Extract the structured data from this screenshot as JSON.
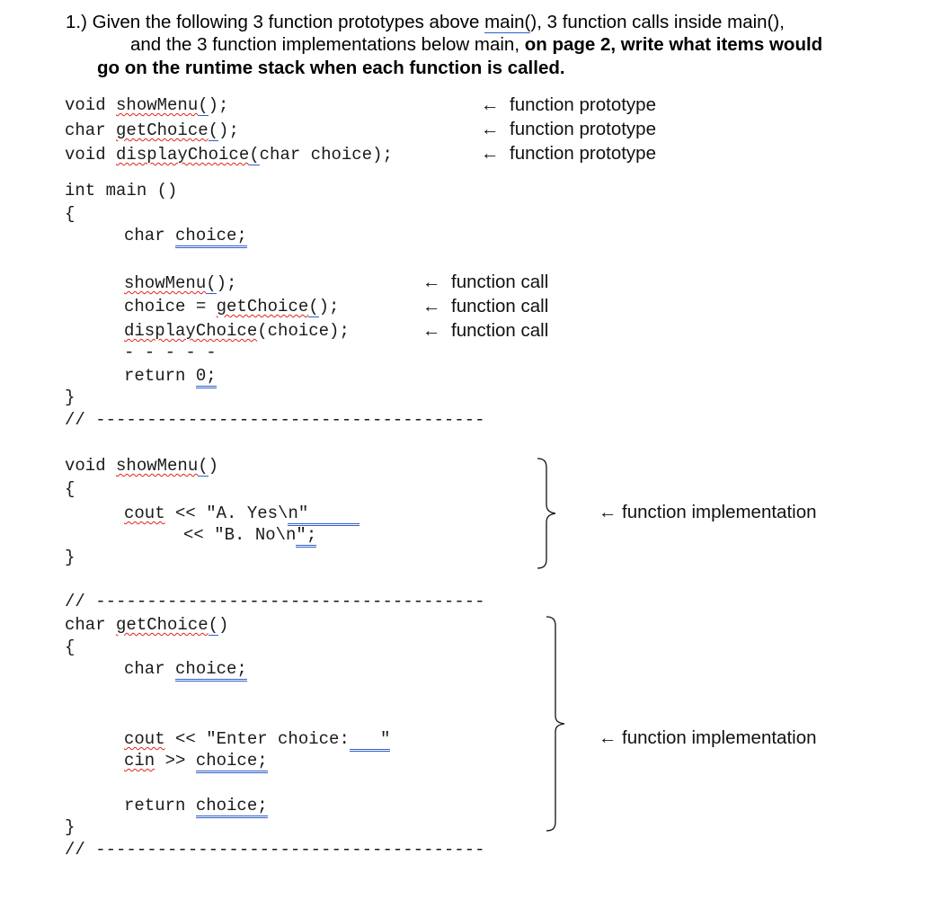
{
  "question": {
    "number": "1.)",
    "line1_pre": "Given the following 3 function prototypes above ",
    "line1_link": "main(",
    "line1_post": "), 3 function calls inside main(),",
    "line2_plain": "and the 3 function implementations below main, ",
    "line2_bold": "on page 2, write what items would",
    "line3_bold": "go on the runtime stack when each function is called."
  },
  "prototypes": [
    {
      "type": "void ",
      "name": "showMenu",
      "paren": "(",
      "rest": ");",
      "annotation": "function prototype"
    },
    {
      "type": "char ",
      "name": "getChoice",
      "paren": "(",
      "rest": ");",
      "annotation": "function prototype"
    },
    {
      "type": "void ",
      "name": "displayChoice",
      "paren": "(",
      "rest": "char choice);",
      "annotation": "function prototype"
    }
  ],
  "arrow": "←",
  "main": {
    "signature": "int main ()",
    "open_brace": "{",
    "decl_type": "char ",
    "decl_var": "choice;",
    "calls": [
      {
        "pre": "",
        "name": "showMenu",
        "paren": "(",
        "rest": ");",
        "annotation": "function call"
      },
      {
        "pre": "choice = ",
        "name": "getChoice",
        "paren": "(",
        "rest": ");",
        "annotation": "function call"
      },
      {
        "pre": "",
        "name": "displayChoice",
        "paren": "",
        "rest": "(choice);",
        "annotation": "function call"
      }
    ],
    "ellipsis": "- - - - -",
    "return_kw": "return ",
    "return_val": "0;",
    "close_brace": "}"
  },
  "separator": "// --------------------------------------",
  "showMenu_impl": {
    "signature_type": "void ",
    "signature_name": "showMenu",
    "signature_paren": "(",
    "signature_rest": ")",
    "open_brace": "{",
    "cout": "cout",
    "line1_mid": " << \"A. Yes\\",
    "line1_u": "n\"     ",
    "line2_pre": "<< \"B. No\\n",
    "line2_u": "\";",
    "close_brace": "}",
    "annotation": "function implementation"
  },
  "getChoice_impl": {
    "signature_type": "char ",
    "signature_name": "getChoice",
    "signature_paren": "(",
    "signature_rest": ")",
    "open_brace": "{",
    "decl_type": "char ",
    "decl_var": "choice;",
    "cout": "cout",
    "cout_rest": " << \"Enter choice:",
    "cout_u": "   \"",
    "cin": "cin",
    "cin_op": " >> ",
    "cin_var": "choice;",
    "return_kw": "return ",
    "return_val": "choice;",
    "close_brace": "}",
    "annotation": "function implementation"
  }
}
